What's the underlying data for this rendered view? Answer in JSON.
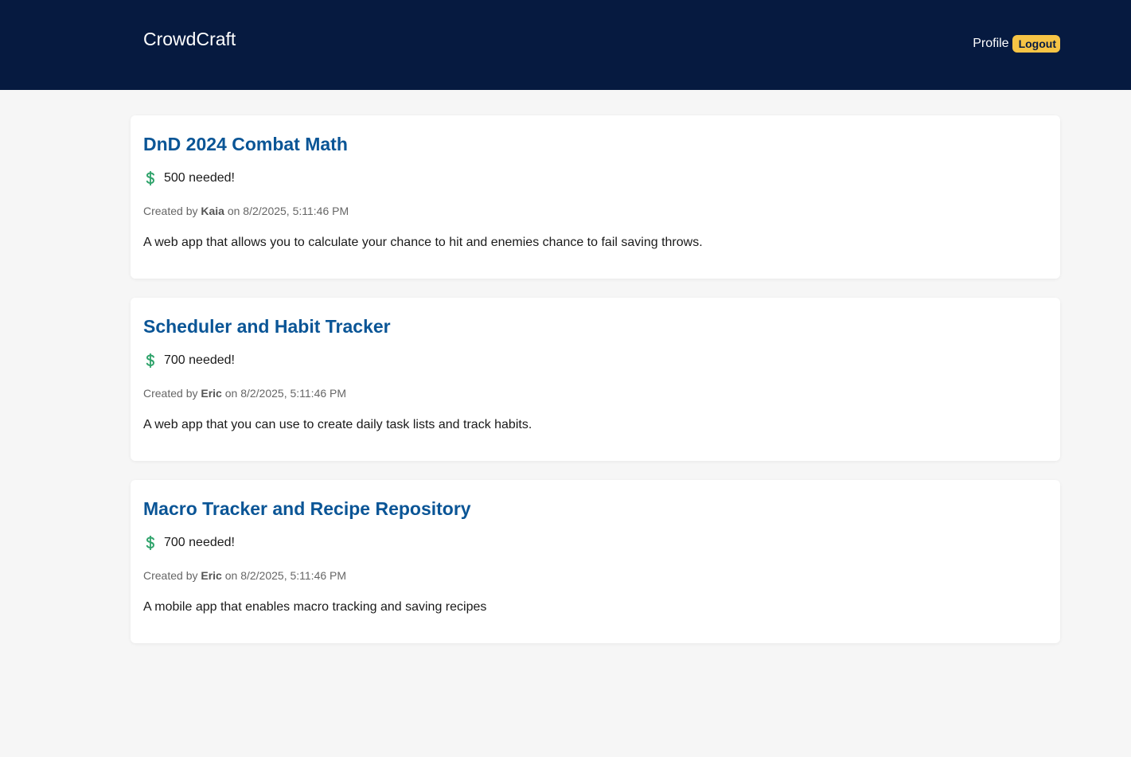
{
  "header": {
    "brand": "CrowdCraft",
    "profile_label": "Profile",
    "logout_label": "Logout"
  },
  "projects": [
    {
      "title": "DnD 2024 Combat Math",
      "funding": "500 needed!",
      "created_prefix": "Created by",
      "author": "Kaia",
      "created_suffix": "on 8/2/2025, 5:11:46 PM",
      "description": "A web app that allows you to calculate your chance to hit and enemies chance to fail saving throws."
    },
    {
      "title": "Scheduler and Habit Tracker",
      "funding": "700 needed!",
      "created_prefix": "Created by",
      "author": "Eric",
      "created_suffix": "on 8/2/2025, 5:11:46 PM",
      "description": "A web app that you can use to create daily task lists and track habits."
    },
    {
      "title": "Macro Tracker and Recipe Repository",
      "funding": "700 needed!",
      "created_prefix": "Created by",
      "author": "Eric",
      "created_suffix": "on 8/2/2025, 5:11:46 PM",
      "description": "A mobile app that enables macro tracking and saving recipes"
    }
  ],
  "icons": {
    "funding": "dollar-icon"
  },
  "colors": {
    "header_bg": "#061a40",
    "accent": "#f6c445",
    "title": "#0a5596",
    "dollar": "#2fa36b"
  }
}
